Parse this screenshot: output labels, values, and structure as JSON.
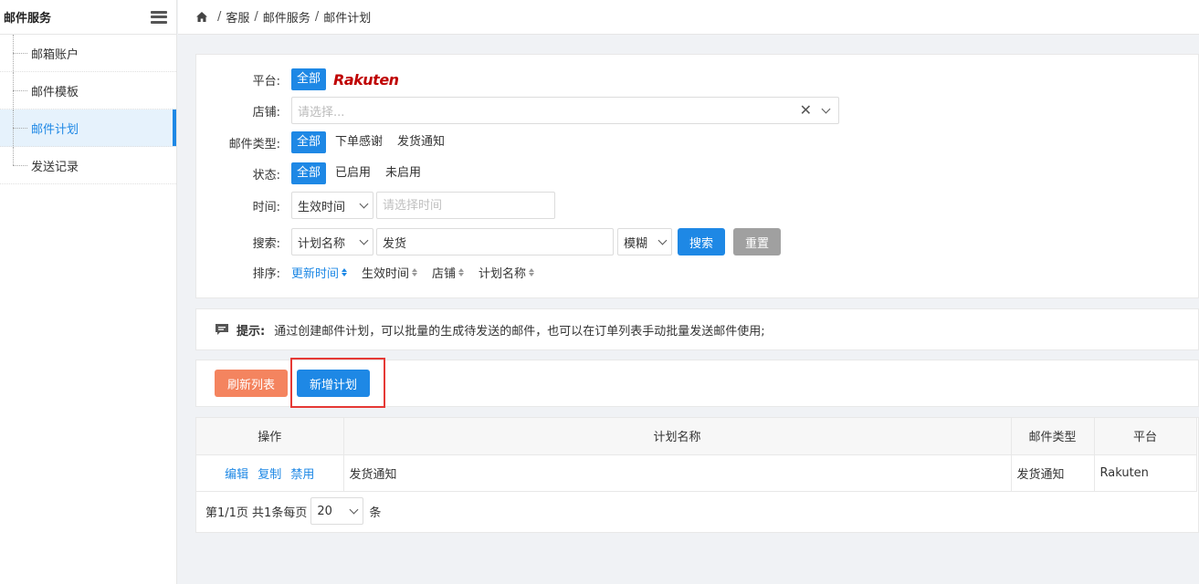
{
  "sidebar": {
    "title": "邮件服务",
    "items": [
      {
        "label": "邮箱账户"
      },
      {
        "label": "邮件模板"
      },
      {
        "label": "邮件计划"
      },
      {
        "label": "发送记录"
      }
    ],
    "active_index": 2
  },
  "breadcrumb": {
    "items": [
      "客服",
      "邮件服务",
      "邮件计划"
    ]
  },
  "filters": {
    "platform": {
      "label": "平台:",
      "options": [
        "全部"
      ],
      "logo_text": "Rakuten"
    },
    "shop": {
      "label": "店铺:",
      "placeholder": "请选择..."
    },
    "mail_type": {
      "label": "邮件类型:",
      "options": [
        "全部",
        "下单感谢",
        "发货通知"
      ]
    },
    "status": {
      "label": "状态:",
      "options": [
        "全部",
        "已启用",
        "未启用"
      ]
    },
    "time": {
      "label": "时间:",
      "select_value": "生效时间",
      "placeholder": "请选择时间"
    },
    "search": {
      "label": "搜索:",
      "field_select": "计划名称",
      "value": "发货",
      "match_select": "模糊",
      "search_button": "搜索",
      "reset_button": "重置"
    },
    "sort": {
      "label": "排序:",
      "options": [
        "更新时间",
        "生效时间",
        "店铺",
        "计划名称"
      ]
    }
  },
  "tip": {
    "label": "提示:",
    "text": "通过创建邮件计划，可以批量的生成待发送的邮件，也可以在订单列表手动批量发送邮件使用;"
  },
  "actions": {
    "refresh_button": "刷新列表",
    "add_button": "新增计划"
  },
  "table": {
    "columns": [
      "操作",
      "计划名称",
      "邮件类型",
      "平台"
    ],
    "rows": [
      {
        "ops": [
          "编辑",
          "复制",
          "禁用"
        ],
        "name": "发货通知",
        "type": "发货通知",
        "platform": "Rakuten"
      }
    ]
  },
  "pager": {
    "summary": "第1/1页 共1条每页",
    "page_size": "20",
    "unit": "条"
  },
  "colors": {
    "primary": "#1e88e5",
    "orange": "#f4845f",
    "gray_button": "#a0a0a0",
    "highlight": "#e53935",
    "rakuten": "#bf0000"
  }
}
